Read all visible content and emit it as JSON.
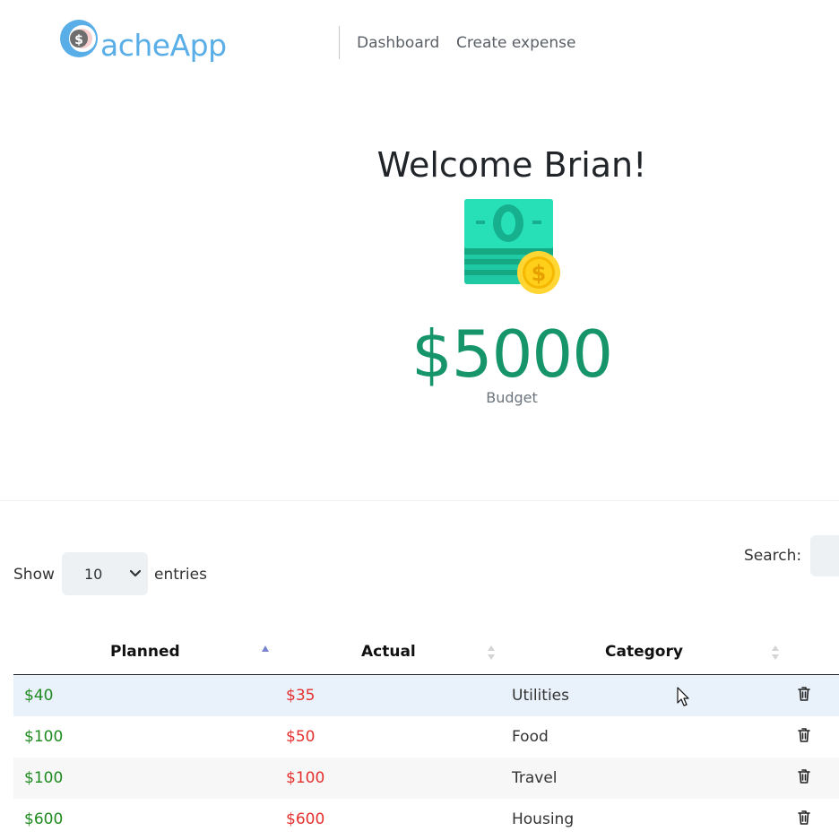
{
  "header": {
    "logo_text": "acheApp",
    "nav": {
      "dashboard": "Dashboard",
      "create_expense": "Create expense"
    }
  },
  "hero": {
    "welcome": "Welcome Brian!",
    "icon": "money-stack-coin-icon",
    "budget_amount": "$5000",
    "budget_label": "Budget"
  },
  "controls": {
    "show_label": "Show",
    "entries_select": "10",
    "entries_label": "entries",
    "search_label": "Search:",
    "search_value": ""
  },
  "table": {
    "columns": [
      "Planned",
      "Actual",
      "Category"
    ],
    "sorted_column": "Planned",
    "sort_direction": "ascending",
    "rows": [
      {
        "planned": "$40",
        "actual": "$35",
        "category": "Utilities"
      },
      {
        "planned": "$100",
        "actual": "$50",
        "category": "Food"
      },
      {
        "planned": "$100",
        "actual": "$100",
        "category": "Travel"
      },
      {
        "planned": "$600",
        "actual": "$600",
        "category": "Housing"
      }
    ],
    "row_action_icon": "trash-icon"
  },
  "colors": {
    "planned": "#1f8a1f",
    "actual": "#e4312f",
    "budget": "#17956a",
    "logo": "#5aaee8"
  }
}
